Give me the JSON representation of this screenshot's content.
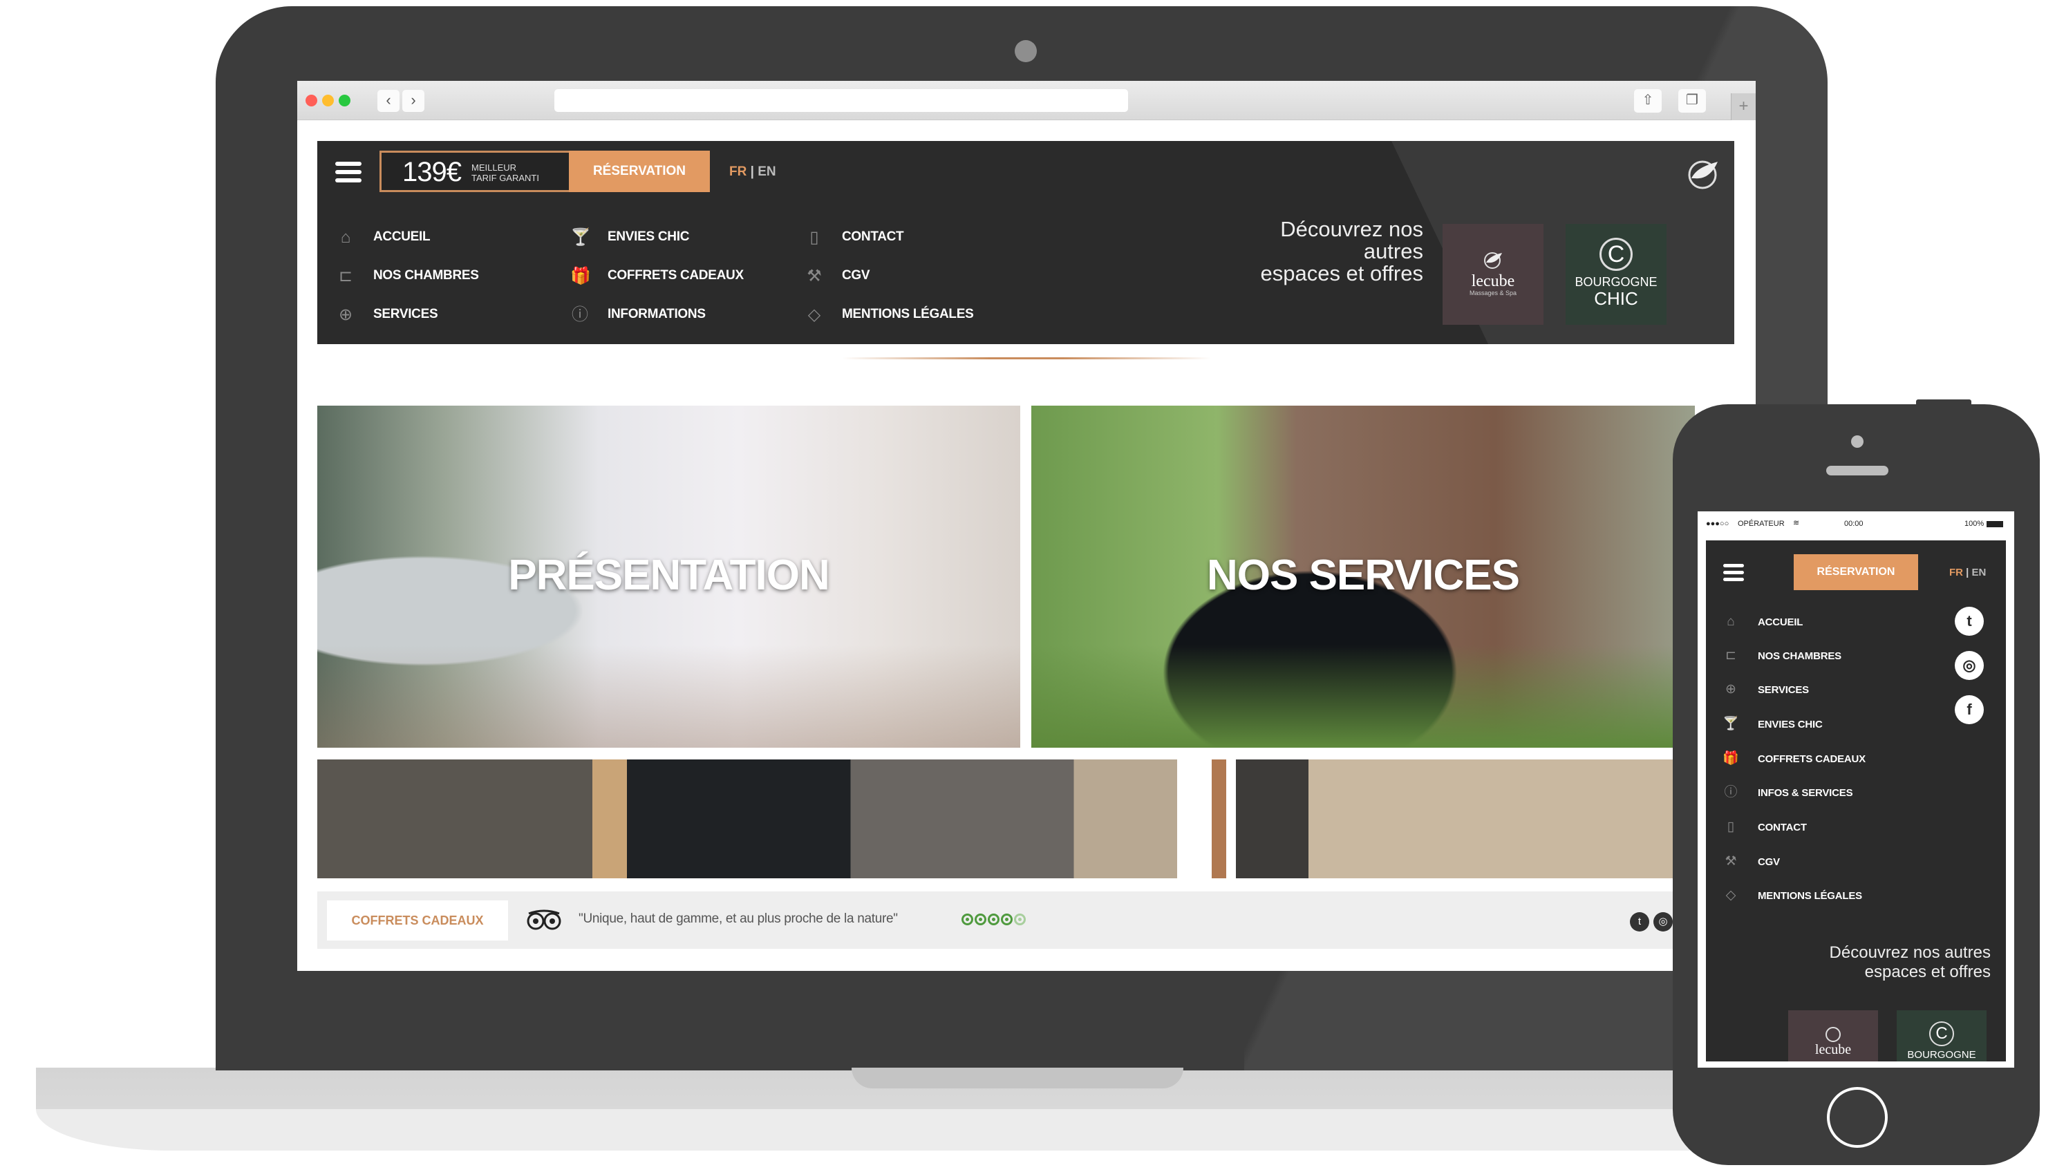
{
  "browser": {
    "traffic_lights": [
      "#ff5f57",
      "#ffbd2e",
      "#28c840"
    ],
    "back_icon": "‹",
    "forward_icon": "›",
    "share_icon": "⇧",
    "tabs_icon": "❐",
    "new_tab_icon": "+",
    "url": ""
  },
  "desktop": {
    "price": "139€",
    "price_note_line1": "MEILLEUR",
    "price_note_line2": "TARIF GARANTI",
    "reservation_label": "RÉSERVATION",
    "lang": {
      "fr": "FR",
      "sep": "|",
      "en": "EN"
    },
    "menu": [
      {
        "icon": "home-icon",
        "glyph": "⌂",
        "label": "ACCUEIL"
      },
      {
        "icon": "bed-icon",
        "glyph": "⊏",
        "label": "NOS CHAMBRES"
      },
      {
        "icon": "plus-circle-icon",
        "glyph": "⊕",
        "label": "SERVICES"
      },
      {
        "icon": "cocktail-icon",
        "glyph": "🍸",
        "label": "ENVIES CHIC"
      },
      {
        "icon": "gift-icon",
        "glyph": "🎁",
        "label": "COFFRETS CADEAUX"
      },
      {
        "icon": "info-icon",
        "glyph": "ⓘ",
        "label": "INFORMATIONS"
      },
      {
        "icon": "phone-icon",
        "glyph": "▯",
        "label": "CONTACT"
      },
      {
        "icon": "gavel-icon",
        "glyph": "⚒",
        "label": "CGV"
      },
      {
        "icon": "tag-icon",
        "glyph": "◇",
        "label": "MENTIONS LÉGALES"
      }
    ],
    "discover_line1": "Découvrez nos autres",
    "discover_line2": "espaces et offres",
    "brands": [
      {
        "name": "lecube",
        "sub": "Massages & Spa",
        "color": "#4a3d40"
      },
      {
        "name": "BOURGOGNE",
        "sub": "CHIC",
        "color": "#2f3f36"
      }
    ],
    "hero_tiles": [
      {
        "title": "PRÉSENTATION"
      },
      {
        "title": "NOS SERVICES"
      }
    ],
    "footer": {
      "coffrets_label": "COFFRETS CADEAUX",
      "quote": "\"Unique, haut de gamme, et au plus proche de la nature\"",
      "rating": 4.5,
      "rating_max": 5
    }
  },
  "phone": {
    "status": {
      "signal": "●●●○○",
      "carrier": "OPÉRATEUR",
      "wifi": "≋",
      "time": "00:00",
      "battery": "100%"
    },
    "reservation_label": "RÉSERVATION",
    "lang": {
      "fr": "FR",
      "sep": "|",
      "en": "EN"
    },
    "menu": [
      {
        "icon": "home-icon",
        "glyph": "⌂",
        "label": "ACCUEIL"
      },
      {
        "icon": "bed-icon",
        "glyph": "⊏",
        "label": "NOS CHAMBRES"
      },
      {
        "icon": "plus-circle-icon",
        "glyph": "⊕",
        "label": "SERVICES"
      },
      {
        "icon": "cocktail-icon",
        "glyph": "🍸",
        "label": "ENVIES CHIC"
      },
      {
        "icon": "gift-icon",
        "glyph": "🎁",
        "label": "COFFRETS CADEAUX"
      },
      {
        "icon": "info-icon",
        "glyph": "ⓘ",
        "label": "INFOS & SERVICES"
      },
      {
        "icon": "phone-icon",
        "glyph": "▯",
        "label": "CONTACT"
      },
      {
        "icon": "gavel-icon",
        "glyph": "⚒",
        "label": "CGV"
      },
      {
        "icon": "tag-icon",
        "glyph": "◇",
        "label": "MENTIONS LÉGALES"
      }
    ],
    "social": [
      {
        "icon": "twitter-icon",
        "glyph": "t"
      },
      {
        "icon": "instagram-icon",
        "glyph": "◎"
      },
      {
        "icon": "facebook-icon",
        "glyph": "f"
      }
    ],
    "discover_line1": "Découvrez nos autres",
    "discover_line2": "espaces et offres",
    "brands": [
      {
        "name": "lecube"
      },
      {
        "name": "BOURGOGNE"
      }
    ]
  },
  "colors": {
    "accent": "#e29a62",
    "panel": "#2b2b2b",
    "device": "#3c3c3c",
    "rating_green": "#4f9a3e"
  }
}
